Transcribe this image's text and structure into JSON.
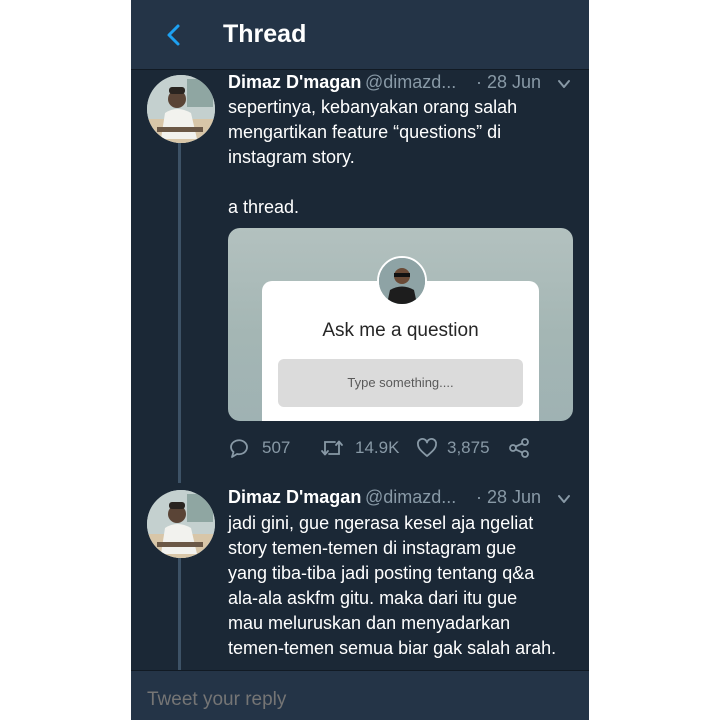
{
  "header": {
    "title": "Thread"
  },
  "tweets": [
    {
      "name": "Dimaz D'magan",
      "handle": "@dimazd...",
      "date": "· 28 Jun",
      "lines": [
        "sepertinya, kebanyakan orang salah",
        "mengartikan feature “questions” di",
        "instagram story.",
        "",
        "a thread."
      ],
      "media": {
        "card_title": "Ask me a question",
        "input_placeholder": "Type something...."
      },
      "stats": {
        "replies": "507",
        "retweets": "14.9K",
        "likes": "3,875"
      }
    },
    {
      "name": "Dimaz D'magan",
      "handle": "@dimazd...",
      "date": "· 28 Jun",
      "lines": [
        "jadi gini, gue ngerasa kesel aja ngeliat",
        "story temen-temen di instagram gue",
        "yang tiba-tiba jadi posting tentang q&a",
        "ala-ala askfm gitu. maka dari itu gue",
        "mau meluruskan dan menyadarkan",
        "temen-temen semua biar gak salah arah."
      ]
    }
  ],
  "reply": {
    "placeholder": "Tweet your reply"
  },
  "colors": {
    "background": "#1b2836",
    "bar": "#243447",
    "accent": "#1da1f2",
    "muted": "#8899a6",
    "text": "#ffffff"
  },
  "icons": {
    "back": "chevron-left-icon",
    "caret": "chevron-down-icon",
    "reply": "speech-bubble-icon",
    "retweet": "retweet-icon",
    "like": "heart-icon",
    "share": "share-icon"
  }
}
